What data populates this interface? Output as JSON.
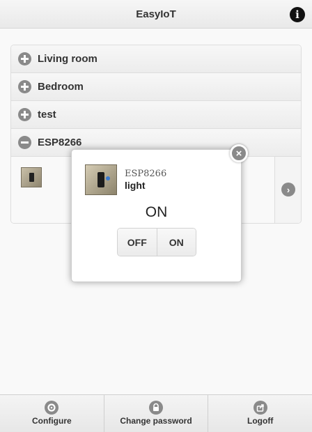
{
  "header": {
    "title": "EasyIoT",
    "info_glyph": "i"
  },
  "groups": [
    {
      "label": "Living room",
      "state": "collapsed"
    },
    {
      "label": "Bedroom",
      "state": "collapsed"
    },
    {
      "label": "test",
      "state": "collapsed"
    },
    {
      "label": "ESP8266",
      "state": "expanded"
    }
  ],
  "popup": {
    "device": "ESP8266",
    "name": "light",
    "state": "ON",
    "buttons": {
      "off": "OFF",
      "on": "ON"
    },
    "close_glyph": "×"
  },
  "footer": {
    "configure": "Configure",
    "change_password": "Change password",
    "logoff": "Logoff"
  },
  "icons": {
    "info": "info-icon",
    "plus": "plus-icon",
    "minus": "minus-icon",
    "arrow": "chevron-right-icon",
    "gear": "gear-icon",
    "lock": "lock-icon",
    "logoff": "logoff-icon"
  },
  "colors": {
    "icon_gray": "#8a8a8a",
    "header_bg": "#ececec",
    "accent_blue": "#3a7ad0"
  }
}
